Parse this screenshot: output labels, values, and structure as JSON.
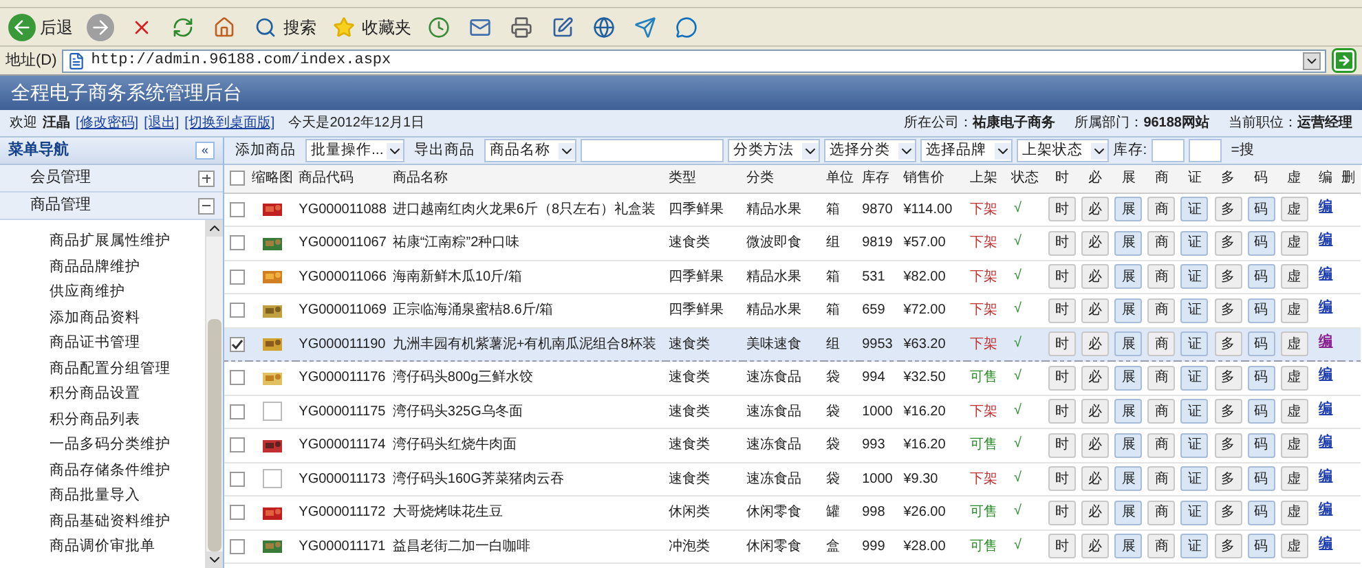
{
  "browser": {
    "toolbar": [
      {
        "kind": "back",
        "label": "后退"
      },
      {
        "kind": "forward"
      },
      {
        "kind": "stop"
      },
      {
        "kind": "refresh"
      },
      {
        "kind": "home"
      },
      {
        "kind": "search",
        "label": "搜索"
      },
      {
        "kind": "favorites",
        "label": "收藏夹"
      },
      {
        "kind": "history"
      },
      {
        "kind": "mail"
      },
      {
        "kind": "print"
      },
      {
        "kind": "edit"
      },
      {
        "kind": "globe"
      },
      {
        "kind": "messenger"
      },
      {
        "kind": "chat"
      }
    ],
    "address_label": "地址(D)",
    "url": "http://admin.96188.com/index.aspx"
  },
  "app_title": "全程电子商务系统管理后台",
  "user_bar": {
    "greeting": "欢迎",
    "user": "汪晶",
    "links": [
      "[修改密码]",
      "[退出]",
      "[切换到桌面版]"
    ],
    "date": "今天是2012年12月1日",
    "info": [
      {
        "label": "所在公司：",
        "value": "祐康电子商务"
      },
      {
        "label": "所属部门：",
        "value": "96188网站"
      },
      {
        "label": "当前职位：",
        "value": "运营经理"
      }
    ]
  },
  "sidebar": {
    "title": "菜单导航",
    "collapse": "«",
    "sections": [
      {
        "label": "会员管理",
        "expanded": false
      },
      {
        "label": "商品管理",
        "expanded": true,
        "children": [
          "商品扩展属性维护",
          "商品品牌维护",
          "供应商维护",
          "添加商品资料",
          "商品证书管理",
          "商品配置分组管理",
          "积分商品设置",
          "积分商品列表",
          "一品多码分类维护",
          "商品存储条件维护",
          "商品批量导入",
          "商品基础资料维护",
          "商品调价审批单"
        ]
      }
    ]
  },
  "filters": [
    {
      "kind": "button",
      "text": "添加商品"
    },
    {
      "kind": "select",
      "text": "批量操作..."
    },
    {
      "kind": "button",
      "text": "导出商品"
    },
    {
      "kind": "select",
      "text": "商品名称"
    },
    {
      "kind": "input"
    },
    {
      "kind": "select",
      "text": "分类方法"
    },
    {
      "kind": "select",
      "text": "选择分类"
    },
    {
      "kind": "select",
      "text": "选择品牌"
    },
    {
      "kind": "select",
      "text": "上架状态"
    },
    {
      "kind": "label",
      "text": "库存:"
    },
    {
      "kind": "input"
    },
    {
      "kind": "input"
    },
    {
      "kind": "button",
      "text": "=搜"
    }
  ],
  "select_all": {
    "checked": false
  },
  "columns": [
    "缩略图",
    "商品代码",
    "商品名称",
    "类型",
    "分类",
    "单位",
    "库存",
    "销售价",
    "上架",
    "状态"
  ],
  "action_columns": [
    {
      "label": "时",
      "kind": "plain"
    },
    {
      "label": "必",
      "kind": "plain"
    },
    {
      "label": "展",
      "kind": "highlight"
    },
    {
      "label": "商",
      "kind": "plain"
    },
    {
      "label": "证",
      "kind": "highlight"
    },
    {
      "label": "多",
      "kind": "plain"
    },
    {
      "label": "码",
      "kind": "highlight"
    },
    {
      "label": "虚",
      "kind": "plain"
    }
  ],
  "edit_column": "编",
  "delete_column": "删",
  "rows": [
    {
      "checked": false,
      "selected": false,
      "code": "YG000011088",
      "name": "进口越南红肉火龙果6斤（8只左右）礼盒装",
      "type": "四季鲜果",
      "category": "精品水果",
      "unit": "箱",
      "stock": "9870",
      "price": "¥114.00",
      "listing": "下架",
      "on_sale": false,
      "status": "√",
      "actions": [
        "时",
        "必",
        "展",
        "商",
        "证",
        "多",
        "码",
        "虚"
      ],
      "edit": "编"
    },
    {
      "checked": false,
      "selected": false,
      "code": "YG000011067",
      "name": "祐康“江南粽”2种口味",
      "type": "速食类",
      "category": "微波即食",
      "unit": "组",
      "stock": "9819",
      "price": "¥57.00",
      "listing": "下架",
      "on_sale": false,
      "status": "√",
      "actions": [
        "时",
        "必",
        "展",
        "商",
        "证",
        "多",
        "码",
        "虚"
      ],
      "edit": "编"
    },
    {
      "checked": false,
      "selected": false,
      "code": "YG000011066",
      "name": "海南新鲜木瓜10斤/箱",
      "type": "四季鲜果",
      "category": "精品水果",
      "unit": "箱",
      "stock": "531",
      "price": "¥82.00",
      "listing": "下架",
      "on_sale": false,
      "status": "√",
      "actions": [
        "时",
        "必",
        "展",
        "商",
        "证",
        "多",
        "码",
        "虚"
      ],
      "edit": "编"
    },
    {
      "checked": false,
      "selected": false,
      "code": "YG000011069",
      "name": "正宗临海涌泉蜜桔8.6斤/箱",
      "type": "四季鲜果",
      "category": "精品水果",
      "unit": "箱",
      "stock": "659",
      "price": "¥72.00",
      "listing": "下架",
      "on_sale": false,
      "status": "√",
      "actions": [
        "时",
        "必",
        "展",
        "商",
        "证",
        "多",
        "码",
        "虚"
      ],
      "edit": "编"
    },
    {
      "checked": true,
      "selected": true,
      "code": "YG000011190",
      "name": "九洲丰园有机紫薯泥+有机南瓜泥组合8杯装",
      "type": "速食类",
      "category": "美味速食",
      "unit": "组",
      "stock": "9953",
      "price": "¥63.20",
      "listing": "下架",
      "on_sale": false,
      "status": "√",
      "actions": [
        "时",
        "必",
        "展",
        "商",
        "证",
        "多",
        "码",
        "虚"
      ],
      "edit": "编"
    },
    {
      "checked": false,
      "selected": false,
      "code": "YG000011176",
      "name": "湾仔码头800g三鲜水饺",
      "type": "速食类",
      "category": "速冻食品",
      "unit": "袋",
      "stock": "994",
      "price": "¥32.50",
      "listing": "可售",
      "on_sale": true,
      "status": "√",
      "actions": [
        "时",
        "必",
        "展",
        "商",
        "证",
        "多",
        "码",
        "虚"
      ],
      "edit": "编"
    },
    {
      "checked": false,
      "selected": false,
      "thumbnail": {
        "kind": "blank"
      },
      "code": "YG000011175",
      "name": "湾仔码头325G乌冬面",
      "type": "速食类",
      "category": "速冻食品",
      "unit": "袋",
      "stock": "1000",
      "price": "¥16.20",
      "listing": "下架",
      "on_sale": false,
      "status": "√",
      "actions": [
        "时",
        "必",
        "展",
        "商",
        "证",
        "多",
        "码",
        "虚"
      ],
      "edit": "编"
    },
    {
      "checked": false,
      "selected": false,
      "code": "YG000011174",
      "name": "湾仔码头红烧牛肉面",
      "type": "速食类",
      "category": "速冻食品",
      "unit": "袋",
      "stock": "993",
      "price": "¥16.20",
      "listing": "可售",
      "on_sale": true,
      "status": "√",
      "actions": [
        "时",
        "必",
        "展",
        "商",
        "证",
        "多",
        "码",
        "虚"
      ],
      "edit": "编"
    },
    {
      "checked": false,
      "selected": false,
      "thumbnail": {
        "kind": "blank"
      },
      "code": "YG000011173",
      "name": "湾仔码头160G荠菜猪肉云吞",
      "type": "速食类",
      "category": "速冻食品",
      "unit": "袋",
      "stock": "1000",
      "price": "¥9.30",
      "listing": "下架",
      "on_sale": false,
      "status": "√",
      "actions": [
        "时",
        "必",
        "展",
        "商",
        "证",
        "多",
        "码",
        "虚"
      ],
      "edit": "编"
    },
    {
      "checked": false,
      "selected": false,
      "code": "YG000011172",
      "name": "大哥烧烤味花生豆",
      "type": "休闲类",
      "category": "休闲零食",
      "unit": "罐",
      "stock": "998",
      "price": "¥26.00",
      "listing": "可售",
      "on_sale": true,
      "status": "√",
      "actions": [
        "时",
        "必",
        "展",
        "商",
        "证",
        "多",
        "码",
        "虚"
      ],
      "edit": "编"
    },
    {
      "checked": false,
      "selected": false,
      "code": "YG000011171",
      "name": "益昌老街二加一白咖啡",
      "type": "冲泡类",
      "category": "休闲零食",
      "unit": "盒",
      "stock": "999",
      "price": "¥28.00",
      "listing": "可售",
      "on_sale": true,
      "status": "√",
      "actions": [
        "时",
        "必",
        "展",
        "商",
        "证",
        "多",
        "码",
        "虚"
      ],
      "edit": "编"
    }
  ]
}
